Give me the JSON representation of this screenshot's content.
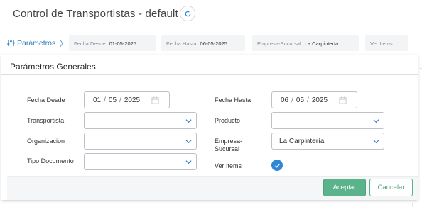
{
  "header": {
    "title": "Control de Transportistas - default",
    "refresh_icon": "refresh-icon"
  },
  "filter_bar": {
    "toggle_label": "Parámetros",
    "toggle_chevron": "〉",
    "chips": [
      {
        "label": "Fecha Desde",
        "value": "01-05-2025"
      },
      {
        "label": "Fecha Hasta",
        "value": "06-05-2025"
      },
      {
        "label": "Empresa-Sucursal",
        "value": "La Carpintería"
      },
      {
        "label": "Ver Items",
        "value": ""
      }
    ]
  },
  "panel": {
    "title": "Parámetros Generales",
    "fields": {
      "fecha_desde": {
        "label": "Fecha Desde",
        "day": "01",
        "month": "05",
        "year": "2025",
        "sep": "/"
      },
      "fecha_hasta": {
        "label": "Fecha Hasta",
        "day": "06",
        "month": "05",
        "year": "2025",
        "sep": "/"
      },
      "transportista": {
        "label": "Transportista",
        "value": ""
      },
      "producto": {
        "label": "Producto",
        "value": ""
      },
      "organizacion": {
        "label": "Organizacion",
        "value": ""
      },
      "empresa_sucursal": {
        "label_line1": "Empresa-",
        "label_line2": "Sucursal",
        "value": "La Carpintería"
      },
      "tipo_documento": {
        "label": "Tipo Documento",
        "value": ""
      },
      "ver_items": {
        "label": "Ver Items",
        "checked": true
      }
    },
    "buttons": {
      "accept": "Aceptar",
      "cancel": "Cancelar"
    }
  },
  "colors": {
    "accent_blue": "#2f86d6",
    "link_blue": "#2f7fc1",
    "accept_green": "#5ab38a"
  }
}
